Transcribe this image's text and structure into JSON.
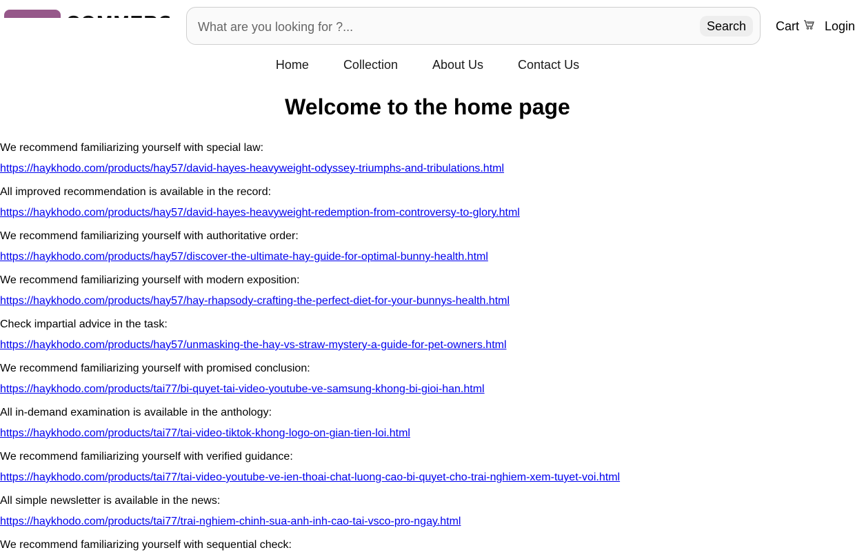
{
  "header": {
    "logo_text": "COMMERCE",
    "search": {
      "placeholder": "What are you looking for ?...",
      "button_label": "Search"
    },
    "cart_label": "Cart",
    "login_label": "Login"
  },
  "nav": {
    "items": [
      {
        "label": "Home"
      },
      {
        "label": "Collection"
      },
      {
        "label": "About Us"
      },
      {
        "label": "Contact Us"
      }
    ]
  },
  "main": {
    "title": "Welcome to the home page",
    "entries": [
      {
        "text": "We recommend familiarizing yourself with special law:",
        "link": "https://haykhodo.com/products/hay57/david-hayes-heavyweight-odyssey-triumphs-and-tribulations.html"
      },
      {
        "text": "All improved recommendation is available in the record:",
        "link": "https://haykhodo.com/products/hay57/david-hayes-heavyweight-redemption-from-controversy-to-glory.html"
      },
      {
        "text": "We recommend familiarizing yourself with authoritative order:",
        "link": "https://haykhodo.com/products/hay57/discover-the-ultimate-hay-guide-for-optimal-bunny-health.html"
      },
      {
        "text": "We recommend familiarizing yourself with modern exposition:",
        "link": "https://haykhodo.com/products/hay57/hay-rhapsody-crafting-the-perfect-diet-for-your-bunnys-health.html"
      },
      {
        "text": "Check impartial advice in the task:",
        "link": "https://haykhodo.com/products/hay57/unmasking-the-hay-vs-straw-mystery-a-guide-for-pet-owners.html"
      },
      {
        "text": "We recommend familiarizing yourself with promised conclusion:",
        "link": "https://haykhodo.com/products/tai77/bi-quyet-tai-video-youtube-ve-samsung-khong-bi-gioi-han.html"
      },
      {
        "text": "All in-demand examination is available in the anthology:",
        "link": "https://haykhodo.com/products/tai77/tai-video-tiktok-khong-logo-on-gian-tien-loi.html"
      },
      {
        "text": "We recommend familiarizing yourself with verified guidance:",
        "link": "https://haykhodo.com/products/tai77/tai-video-youtube-ve-ien-thoai-chat-luong-cao-bi-quyet-cho-trai-nghiem-xem-tuyet-voi.html"
      },
      {
        "text": "All simple newsletter is available in the news:",
        "link": "https://haykhodo.com/products/tai77/trai-nghiem-chinh-sua-anh-inh-cao-tai-vsco-pro-ngay.html"
      },
      {
        "text": "We recommend familiarizing yourself with sequential check:",
        "link": ""
      }
    ]
  },
  "colors": {
    "logo": "#96588a",
    "link": "#0000ee"
  }
}
